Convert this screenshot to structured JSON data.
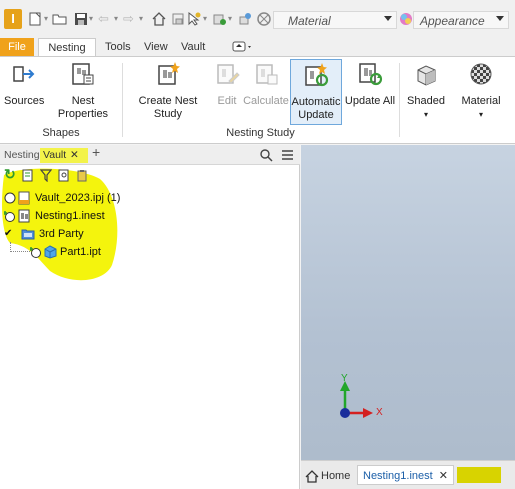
{
  "quick_access": {
    "material_placeholder": "Material",
    "appearance_placeholder": "Appearance"
  },
  "ribbon_tabs": [
    "File",
    "Nesting",
    "Tools",
    "View",
    "Vault"
  ],
  "ribbon": {
    "buttons": {
      "sources": "Sources",
      "nest_properties": "Nest Properties",
      "create_nest_study": "Create Nest Study",
      "edit": "Edit",
      "calculate": "Calculate",
      "automatic_update_1": "Automatic",
      "automatic_update_2": "Update",
      "update_all": "Update All",
      "shaded": "Shaded",
      "material": "Material"
    },
    "groups": {
      "shapes": "Shapes",
      "nesting_study": "Nesting Study"
    }
  },
  "browser": {
    "tab_nesting": "Nesting",
    "tab_vault": "Vault",
    "tree": [
      {
        "label": "Vault_2023.ipj (1)"
      },
      {
        "label": "Nesting1.inest"
      },
      {
        "label": "3rd Party"
      },
      {
        "label": "Part1.ipt"
      }
    ]
  },
  "viewport": {
    "axis_y": "Y",
    "axis_x": "X"
  },
  "doc_tabs": {
    "home": "Home",
    "active": "Nesting1.inest"
  },
  "colors": {
    "file_tab": "#f0a21b",
    "highlight": "#f3f300",
    "axis_x": "#d42020",
    "axis_y": "#22a62a",
    "origin": "#1a2e9c"
  }
}
